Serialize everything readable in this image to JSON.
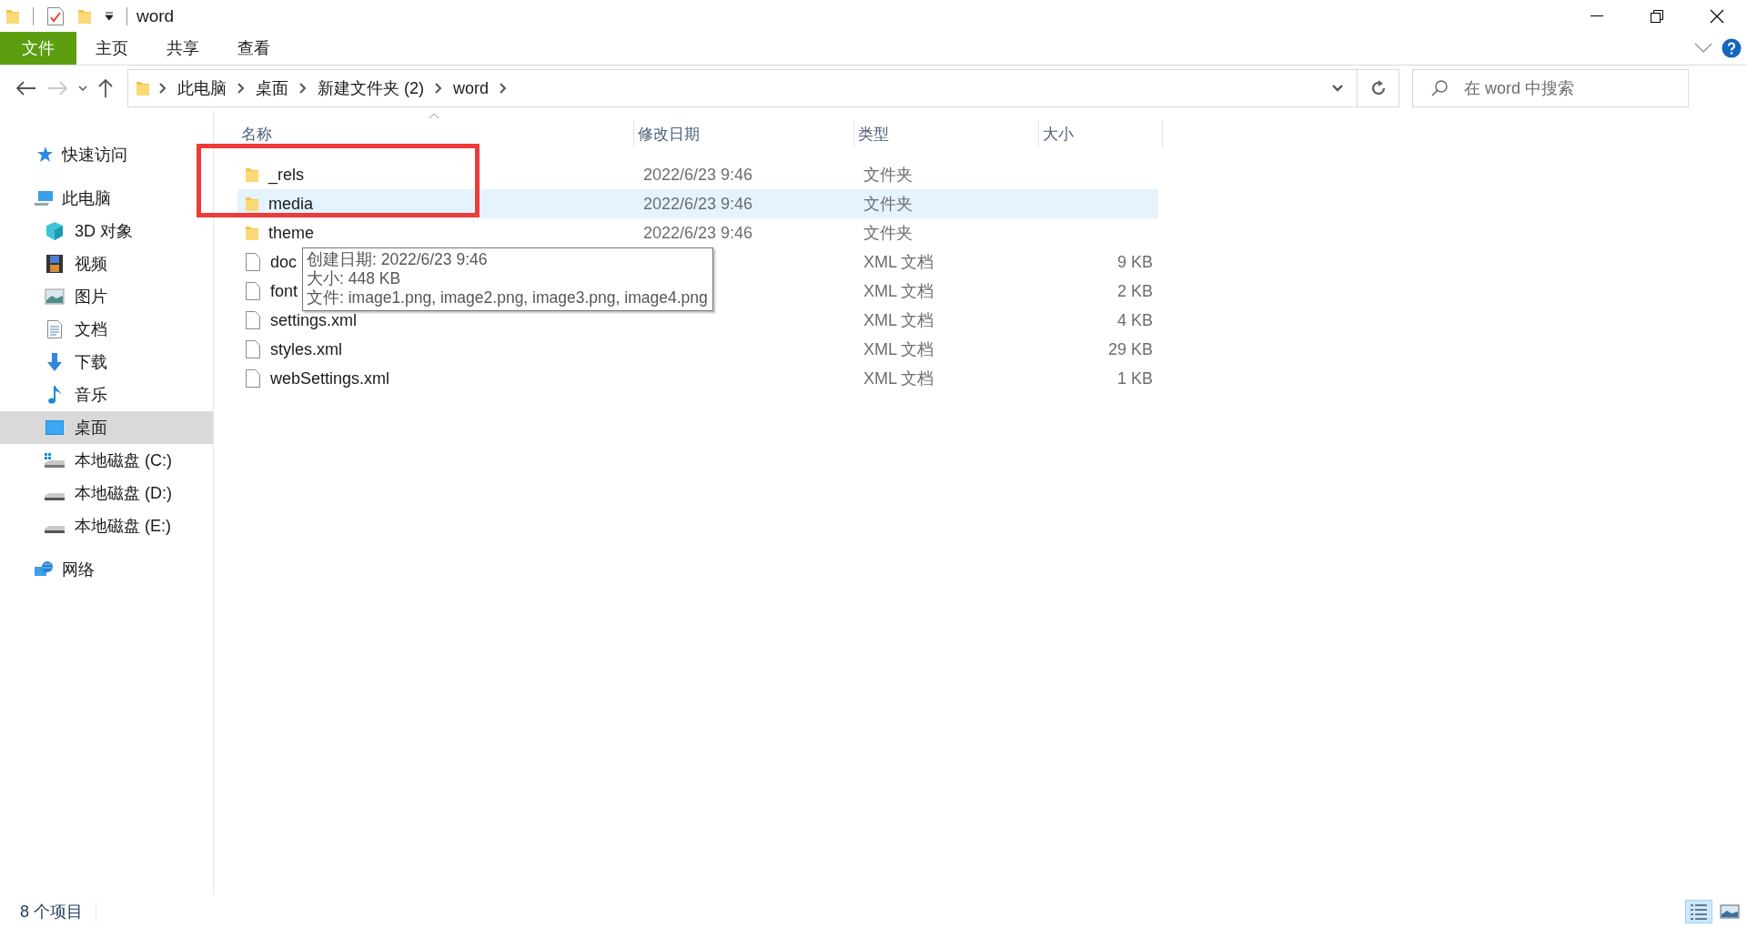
{
  "window": {
    "title": "word"
  },
  "ribbon_tabs": [
    {
      "label": "文件",
      "kind": "file"
    },
    {
      "label": "主页",
      "kind": "tab"
    },
    {
      "label": "共享",
      "kind": "tab"
    },
    {
      "label": "查看",
      "kind": "tab"
    }
  ],
  "address": {
    "breadcrumbs": [
      "此电脑",
      "桌面",
      "新建文件夹 (2)",
      "word"
    ]
  },
  "search": {
    "placeholder": "在 word 中搜索"
  },
  "sidebar": {
    "items": [
      {
        "label": "快速访问",
        "selected": false
      },
      {
        "label": "此电脑",
        "selected": false,
        "children": [
          {
            "label": "3D 对象",
            "selected": false
          },
          {
            "label": "视频",
            "selected": false
          },
          {
            "label": "图片",
            "selected": false
          },
          {
            "label": "文档",
            "selected": false
          },
          {
            "label": "下载",
            "selected": false
          },
          {
            "label": "音乐",
            "selected": false
          },
          {
            "label": "桌面",
            "selected": true
          },
          {
            "label": "本地磁盘 (C:)",
            "selected": false
          },
          {
            "label": "本地磁盘 (D:)",
            "selected": false
          },
          {
            "label": "本地磁盘 (E:)",
            "selected": false
          }
        ]
      },
      {
        "label": "网络",
        "selected": false
      }
    ]
  },
  "table": {
    "columns": [
      "名称",
      "修改日期",
      "类型",
      "大小"
    ],
    "rows": [
      {
        "kind": "folder",
        "name": "_rels",
        "date": "2022/6/23 9:46",
        "type": "文件夹",
        "selected": false
      },
      {
        "kind": "folder",
        "name": "media",
        "date": "2022/6/23 9:46",
        "type": "文件夹",
        "selected": true
      },
      {
        "kind": "folder",
        "name": "theme",
        "date": "2022/6/23 9:46",
        "type": "文件夹",
        "selected": false
      },
      {
        "kind": "file",
        "name": "doc",
        "type": "XML 文档",
        "size": "9 KB",
        "selected": false
      },
      {
        "kind": "file",
        "name": "font",
        "type": "XML 文档",
        "size": "2 KB",
        "selected": false
      },
      {
        "kind": "file",
        "name": "settings.xml",
        "type": "XML 文档",
        "size": "4 KB",
        "selected": false
      },
      {
        "kind": "file",
        "name": "styles.xml",
        "type": "XML 文档",
        "size": "29 KB",
        "selected": false
      },
      {
        "kind": "file",
        "name": "webSettings.xml",
        "type": "XML 文档",
        "size": "1 KB",
        "selected": false
      }
    ]
  },
  "tooltip": {
    "lines": [
      "创建日期: 2022/6/23 9:46",
      "大小: 448 KB",
      "文件: image1.png, image2.png, image3.png, image4.png"
    ]
  },
  "status_bar": {
    "item_count": "8 个项目"
  },
  "view_buttons": [
    {
      "kind": "details",
      "selected": true
    },
    {
      "kind": "large-icons",
      "selected": false
    }
  ]
}
